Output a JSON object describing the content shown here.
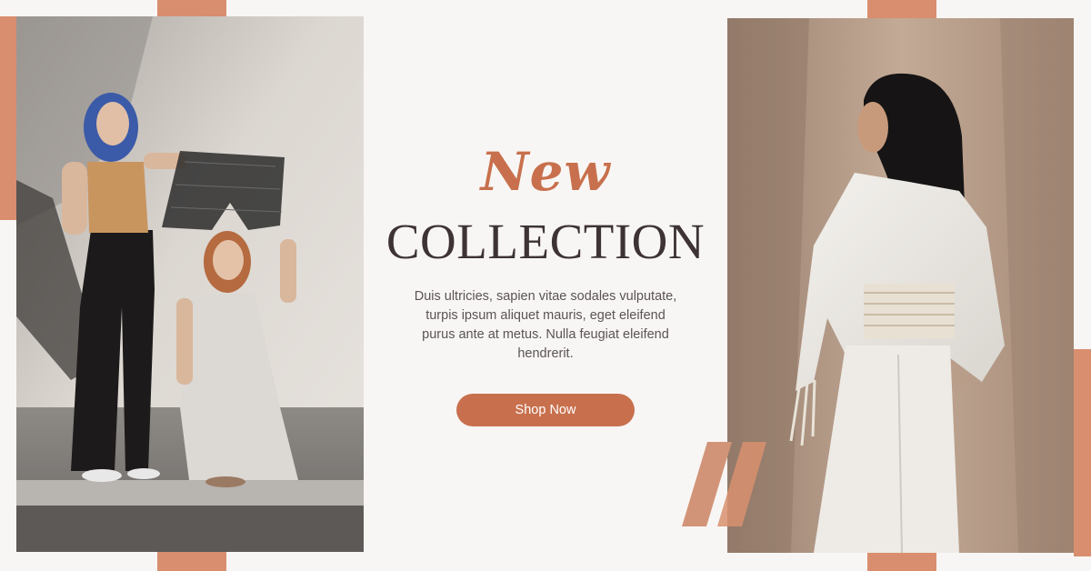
{
  "headline": {
    "accent_word": "New",
    "main_word": "COLLECTION"
  },
  "description": "Duis ultricies, sapien vitae sodales vulputate, turpis ipsum aliquet mauris, eget eleifend purus ante at metus. Nulla feugiat eleifend hendrerit.",
  "cta": {
    "label": "Shop Now"
  },
  "colors": {
    "background": "#f8f6f4",
    "accent": "#c8704d",
    "accent_light": "#d98e6f",
    "heading": "#3d3335",
    "body_text": "#5b5355"
  }
}
